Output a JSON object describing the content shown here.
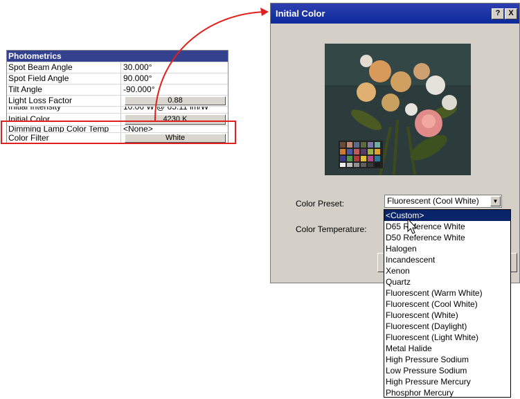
{
  "properties": {
    "header": "Photometrics",
    "rows": [
      {
        "name": "Spot Beam Angle",
        "value": "30.000°"
      },
      {
        "name": "Spot Field Angle",
        "value": "90.000°"
      },
      {
        "name": "Tilt Angle",
        "value": "-90.000°"
      },
      {
        "name": "Light Loss Factor",
        "value": "0.88"
      },
      {
        "name": "Initial Intensity",
        "value": "10.00 W @ 65.11 lm/W"
      },
      {
        "name": "Initial Color",
        "value": "4230 K"
      },
      {
        "name": "Dimming Lamp Color Temp",
        "value": "<None>"
      },
      {
        "name": "Color Filter",
        "value": "White"
      }
    ]
  },
  "dialog": {
    "title": "Initial Color",
    "help_button": "?",
    "close_button": "X",
    "color_preset_label": "Color Preset:",
    "color_preset_value": "Fluorescent (Cool White)",
    "color_temperature_label": "Color Temperature:",
    "preset_options": [
      "<Custom>",
      "D65 Reference White",
      "D50 Reference White",
      "Halogen",
      "Incandescent",
      "Xenon",
      "Quartz",
      "Fluorescent (Warm White)",
      "Fluorescent (Cool White)",
      "Fluorescent (White)",
      "Fluorescent (Daylight)",
      "Fluorescent (Light White)",
      "Metal Halide",
      "High Pressure Sodium",
      "Low Pressure Sodium",
      "High Pressure Mercury",
      "Phosphor Mercury"
    ],
    "selected_option": "<Custom>"
  },
  "colors": {
    "callout": "#e0201c",
    "titlebar": "#0b2a9a",
    "header": "#33418f",
    "selection": "#0a246a"
  }
}
